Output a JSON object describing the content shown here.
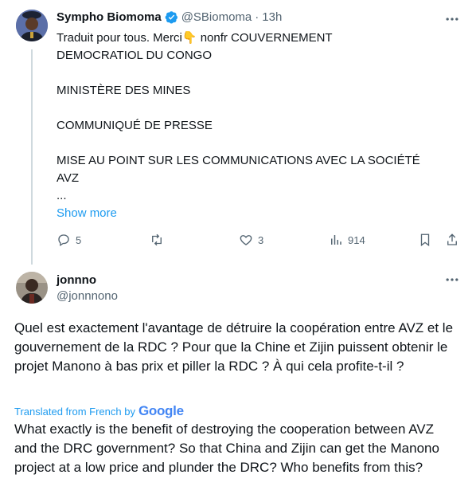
{
  "tweet1": {
    "author_name": "Sympho Biomoma",
    "handle": "@SBiomoma",
    "separator": "·",
    "time": "13h",
    "text_before_emoji": "Traduit pour tous. Merci",
    "emoji": "👇",
    "text_after_emoji": " nonfr COUVERNEMENT\nDEMOCRATIOL DU CONGO\n\nMINISTÈRE DES MINES\n\nCOMMUNIQUÉ DE PRESSE\n\nMISE AU POINT SUR LES COMMUNICATIONS AVEC LA SOCIÉTÉ\nAVZ\n...",
    "show_more": "Show more",
    "actions": {
      "replies": "5",
      "retweets": "",
      "likes": "3",
      "views": "914"
    }
  },
  "tweet2": {
    "author_name": "jonnno",
    "handle": "@jonnnono",
    "text_fr": "Quel est exactement l'avantage de détruire la coopération entre AVZ et le gouvernement de la RDC ? Pour que la Chine et Zijin puissent obtenir le projet Manono à bas prix et piller la RDC ? À qui cela profite-t-il ?",
    "translated_label": "Translated from French by",
    "google_logo": "Google",
    "text_en": "What exactly is the benefit of destroying the cooperation between AVZ and the DRC government? So that China and Zijin can get the Manono project at a low price and plunder the DRC? Who benefits from this?"
  },
  "colors": {
    "verified": "#1d9bf0",
    "link": "#1d9bf0",
    "muted": "#536471"
  },
  "icons": [
    "verified-badge-icon",
    "more-icon",
    "reply-icon",
    "retweet-icon",
    "like-icon",
    "views-icon",
    "bookmark-icon",
    "share-icon"
  ]
}
